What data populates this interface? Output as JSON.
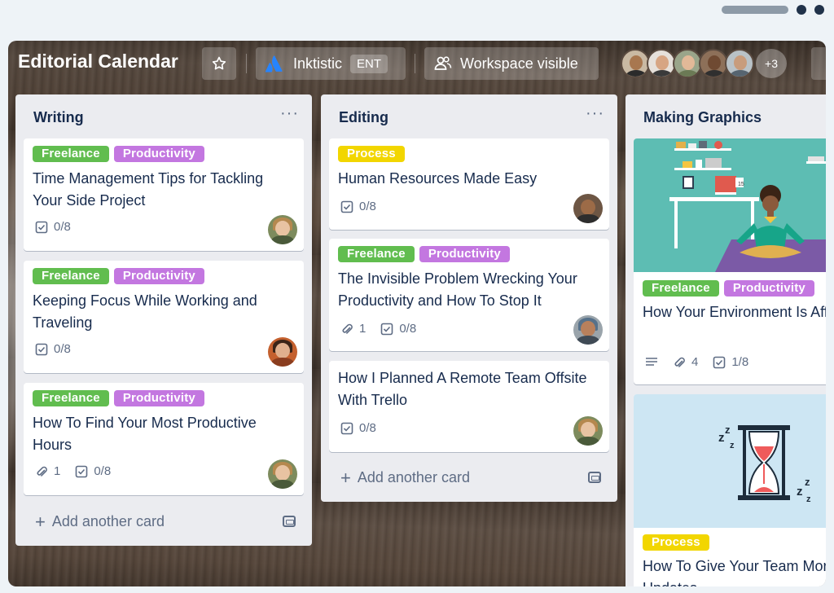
{
  "board": {
    "title": "Editorial Calendar",
    "workspace_name": "Inktistic",
    "workspace_badge": "ENT",
    "visibility": "Workspace visible",
    "more_members": "+3"
  },
  "colors": {
    "freelance": "#61bd4f",
    "productivity": "#c377e0",
    "process": "#f2d600"
  },
  "lists": [
    {
      "title": "Writing",
      "menu": "···",
      "add_card": "Add another card",
      "cards": [
        {
          "labels": [
            "Freelance",
            "Productivity"
          ],
          "title": "Time Management Tips for Tackling Your Side Project",
          "checklist": "0/8"
        },
        {
          "labels": [
            "Freelance",
            "Productivity"
          ],
          "title": "Keeping Focus While Working and Traveling",
          "checklist": "0/8"
        },
        {
          "labels": [
            "Freelance",
            "Productivity"
          ],
          "title": "How To Find Your Most Productive Hours",
          "attachments": "1",
          "checklist": "0/8"
        }
      ]
    },
    {
      "title": "Editing",
      "menu": "···",
      "add_card": "Add another card",
      "cards": [
        {
          "labels": [
            "Process"
          ],
          "title": "Human Resources Made Easy",
          "checklist": "0/8"
        },
        {
          "labels": [
            "Freelance",
            "Productivity"
          ],
          "title": "The Invisible Problem Wrecking Your Productivity and How To Stop It",
          "attachments": "1",
          "checklist": "0/8"
        },
        {
          "labels": [],
          "title": "How I Planned A Remote Team Offsite With Trello",
          "checklist": "0/8"
        }
      ]
    },
    {
      "title": "Making Graphics",
      "cards": [
        {
          "labels": [
            "Freelance",
            "Productivity"
          ],
          "title": "How Your Environment Is Affecting Your Productivity",
          "attachments": "4",
          "checklist": "1/8"
        },
        {
          "labels": [
            "Process"
          ],
          "title": "How To Give Your Team More Status Updates"
        }
      ]
    }
  ]
}
